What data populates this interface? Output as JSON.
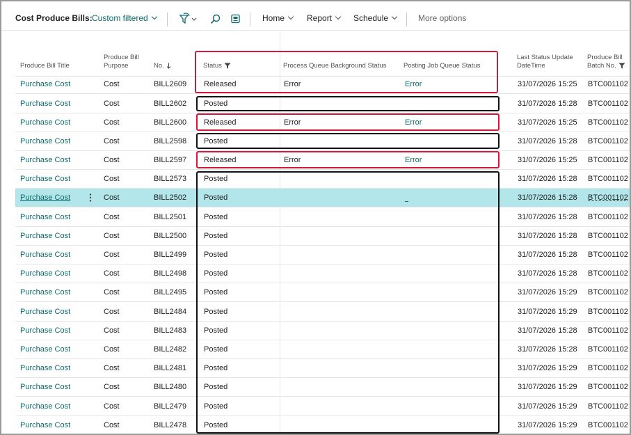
{
  "toolbar": {
    "page_title": "Cost Produce Bills:",
    "filter_name": "Custom filtered",
    "menu": {
      "home": "Home",
      "report": "Report",
      "schedule": "Schedule",
      "more": "More options"
    },
    "icons": [
      "filter-pane-icon",
      "search-icon",
      "edit-in-excel-icon"
    ]
  },
  "columns": {
    "title": "Produce Bill Title",
    "purpose_1": "Produce Bill",
    "purpose_2": "Purpose",
    "no": "No.",
    "status": "Status",
    "pqbs": "Process Queue Background Status",
    "pjqs": "Posting Job Queue Status",
    "date_1": "Last Status Update",
    "date_2": "DateTime",
    "batch_1": "Produce Bill",
    "batch_2": "Batch No."
  },
  "rows": [
    {
      "title": "Purchase Cost",
      "purpose": "Cost",
      "no": "BILL2609",
      "status": "Released",
      "pqbs": "Error",
      "pjqs": "Error",
      "date": "31/07/2026 15:25",
      "batch": "BTC001102"
    },
    {
      "title": "Purchase Cost",
      "purpose": "Cost",
      "no": "BILL2602",
      "status": "Posted",
      "pqbs": "",
      "pjqs": "",
      "date": "31/07/2026 15:28",
      "batch": "BTC001102"
    },
    {
      "title": "Purchase Cost",
      "purpose": "Cost",
      "no": "BILL2600",
      "status": "Released",
      "pqbs": "Error",
      "pjqs": "Error",
      "date": "31/07/2026 15:25",
      "batch": "BTC001102"
    },
    {
      "title": "Purchase Cost",
      "purpose": "Cost",
      "no": "BILL2598",
      "status": "Posted",
      "pqbs": "",
      "pjqs": "",
      "date": "31/07/2026 15:28",
      "batch": "BTC001102"
    },
    {
      "title": "Purchase Cost",
      "purpose": "Cost",
      "no": "BILL2597",
      "status": "Released",
      "pqbs": "Error",
      "pjqs": "Error",
      "date": "31/07/2026 15:25",
      "batch": "BTC001102"
    },
    {
      "title": "Purchase Cost",
      "purpose": "Cost",
      "no": "BILL2573",
      "status": "Posted",
      "pqbs": "",
      "pjqs": "",
      "date": "31/07/2026 15:28",
      "batch": "BTC001102"
    },
    {
      "title": "Purchase Cost",
      "purpose": "Cost",
      "no": "BILL2502",
      "status": "Posted",
      "pqbs": "",
      "pjqs": "",
      "date": "31/07/2026 15:28",
      "batch": "BTC001102",
      "selected": true
    },
    {
      "title": "Purchase Cost",
      "purpose": "Cost",
      "no": "BILL2501",
      "status": "Posted",
      "pqbs": "",
      "pjqs": "",
      "date": "31/07/2026 15:28",
      "batch": "BTC001102"
    },
    {
      "title": "Purchase Cost",
      "purpose": "Cost",
      "no": "BILL2500",
      "status": "Posted",
      "pqbs": "",
      "pjqs": "",
      "date": "31/07/2026 15:28",
      "batch": "BTC001102"
    },
    {
      "title": "Purchase Cost",
      "purpose": "Cost",
      "no": "BILL2499",
      "status": "Posted",
      "pqbs": "",
      "pjqs": "",
      "date": "31/07/2026 15:28",
      "batch": "BTC001102"
    },
    {
      "title": "Purchase Cost",
      "purpose": "Cost",
      "no": "BILL2498",
      "status": "Posted",
      "pqbs": "",
      "pjqs": "",
      "date": "31/07/2026 15:28",
      "batch": "BTC001102"
    },
    {
      "title": "Purchase Cost",
      "purpose": "Cost",
      "no": "BILL2495",
      "status": "Posted",
      "pqbs": "",
      "pjqs": "",
      "date": "31/07/2026 15:29",
      "batch": "BTC001102"
    },
    {
      "title": "Purchase Cost",
      "purpose": "Cost",
      "no": "BILL2484",
      "status": "Posted",
      "pqbs": "",
      "pjqs": "",
      "date": "31/07/2026 15:29",
      "batch": "BTC001102"
    },
    {
      "title": "Purchase Cost",
      "purpose": "Cost",
      "no": "BILL2483",
      "status": "Posted",
      "pqbs": "",
      "pjqs": "",
      "date": "31/07/2026 15:28",
      "batch": "BTC001102"
    },
    {
      "title": "Purchase Cost",
      "purpose": "Cost",
      "no": "BILL2482",
      "status": "Posted",
      "pqbs": "",
      "pjqs": "",
      "date": "31/07/2026 15:28",
      "batch": "BTC001102"
    },
    {
      "title": "Purchase Cost",
      "purpose": "Cost",
      "no": "BILL2481",
      "status": "Posted",
      "pqbs": "",
      "pjqs": "",
      "date": "31/07/2026 15:29",
      "batch": "BTC001102"
    },
    {
      "title": "Purchase Cost",
      "purpose": "Cost",
      "no": "BILL2480",
      "status": "Posted",
      "pqbs": "",
      "pjqs": "",
      "date": "31/07/2026 15:29",
      "batch": "BTC001102"
    },
    {
      "title": "Purchase Cost",
      "purpose": "Cost",
      "no": "BILL2479",
      "status": "Posted",
      "pqbs": "",
      "pjqs": "",
      "date": "31/07/2026 15:29",
      "batch": "BTC001102"
    },
    {
      "title": "Purchase Cost",
      "purpose": "Cost",
      "no": "BILL2478",
      "status": "Posted",
      "pqbs": "",
      "pjqs": "",
      "date": "31/07/2026 15:29",
      "batch": "BTC001102"
    }
  ],
  "colors": {
    "accent": "#0b6a6a",
    "selected_row": "#b2e6ea",
    "annotation_red": "#d0193b",
    "annotation_black": "#111111"
  }
}
